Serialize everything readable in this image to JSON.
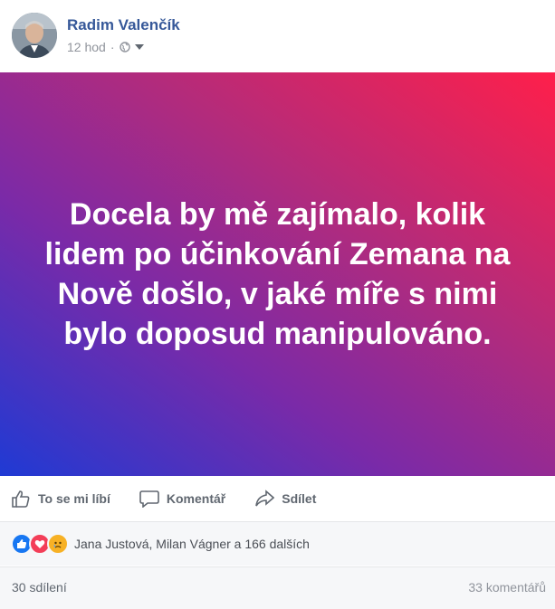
{
  "header": {
    "author": "Radim Valenčík",
    "time": "12 hod",
    "separator": "·"
  },
  "post": {
    "text": "Docela by mě zajímalo, kolik lidem po účinkování Zemana na Nově došlo, v jaké míře s nimi bylo doposud manipulováno.",
    "gradient_colors": [
      "#1f3ad4",
      "#7a2aa8",
      "#b52b7a",
      "#ff1f4a"
    ]
  },
  "actions": {
    "like": "To se mi líbí",
    "comment": "Komentář",
    "share": "Sdílet"
  },
  "reactions": {
    "icons": [
      "like-icon",
      "love-icon",
      "sad-icon"
    ],
    "summary": "Jana Justová, Milan Vágner a 166 dalších"
  },
  "footer": {
    "shares": "30 sdílení",
    "comments": "33 komentářů"
  },
  "colors": {
    "link": "#365899",
    "muted": "#90949c"
  }
}
